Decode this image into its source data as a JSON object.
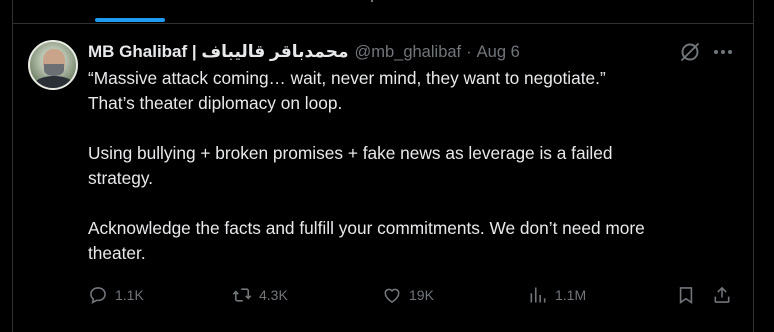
{
  "tweet": {
    "author_name": "محمدباقر قالیباف | MB Ghalibaf",
    "handle": "@mb_ghalibaf",
    "separator": "·",
    "date": "Aug 6",
    "paragraphs": [
      "“Massive attack coming… wait, never mind, they want to negotiate.”",
      "That’s theater diplomacy on loop.",
      "Using bullying + broken promises + fake news as leverage is a failed",
      "strategy.",
      "Acknowledge the facts and fulfill your commitments. We don’t need more",
      "theater."
    ]
  },
  "actions": {
    "replies": "1.1K",
    "reposts": "4.3K",
    "likes": "19K",
    "views": "1.1M"
  },
  "icons": {
    "grok": "grok-icon",
    "more": "more-horizontal-icon",
    "reply": "reply-icon",
    "repost": "repost-icon",
    "like": "heart-icon",
    "views": "views-chart-icon",
    "bookmark": "bookmark-icon",
    "share": "share-icon"
  },
  "colors": {
    "background": "#000000",
    "text": "#e7e9ea",
    "muted": "#71767b",
    "accent": "#1d9bf0",
    "border": "#2f3336"
  }
}
